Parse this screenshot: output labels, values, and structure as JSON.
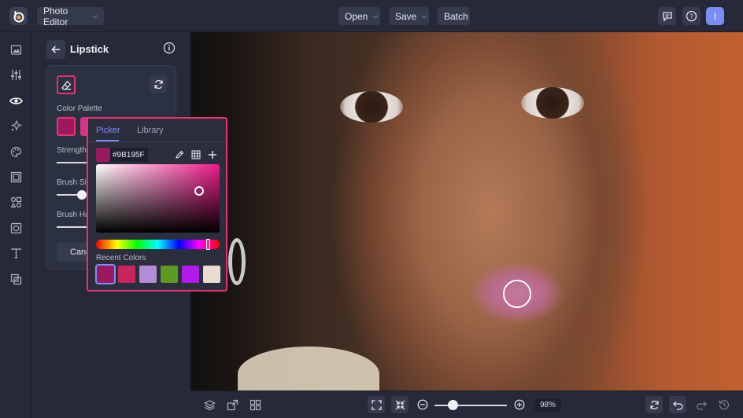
{
  "header": {
    "app_menu_label": "Photo Editor",
    "open_label": "Open",
    "save_label": "Save",
    "batch_label": "Batch",
    "avatar_initial": "I"
  },
  "panel": {
    "title": "Lipstick",
    "color_palette_label": "Color Palette",
    "strength_label": "Strength",
    "brush_size_label": "Brush Size",
    "brush_hardness_label": "Brush Hardness",
    "cancel_label": "Cancel"
  },
  "picker": {
    "tab_picker": "Picker",
    "tab_library": "Library",
    "hex_value": "#9B195F",
    "recent_label": "Recent Colors",
    "recent_colors": [
      "#9B195F",
      "#C8245E",
      "#B48BD6",
      "#5E9A22",
      "#B21BEA",
      "#EADDD0"
    ]
  },
  "zoom": {
    "value": "98%",
    "level": 0.25
  },
  "colors": {
    "accent": "#E8336F",
    "tab_active": "#7D8FF5",
    "panel_bg": "#262A38"
  },
  "icons": {
    "rail": [
      "image-icon",
      "sliders-icon",
      "eye-icon",
      "sparkle-icon",
      "palette-icon",
      "frame-icon",
      "shapes-icon",
      "texture-icon",
      "text-icon",
      "overlay-icon"
    ],
    "bottom_left": [
      "layers-icon",
      "resize-icon",
      "grid-icon"
    ],
    "bottom_right": [
      "sync-icon",
      "undo-icon",
      "redo-icon",
      "history-icon"
    ]
  }
}
